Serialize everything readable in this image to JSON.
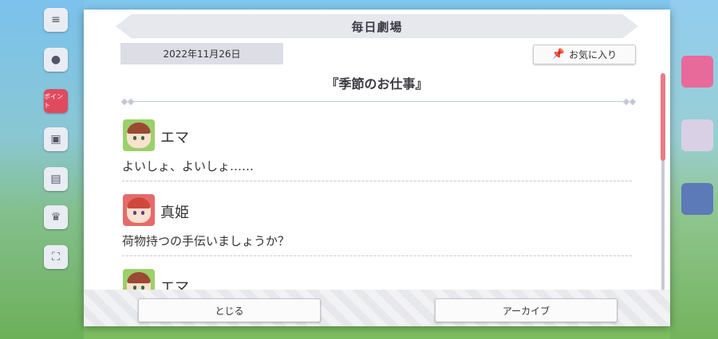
{
  "panel": {
    "title": "毎日劇場",
    "date": "2022年11月26日",
    "favorite_label": "お気に入り",
    "story_title": "『季節のお仕事』"
  },
  "entries": [
    {
      "speaker": "エマ",
      "text": "よいしょ、よいしょ……"
    },
    {
      "speaker": "真姫",
      "text": "荷物持つの手伝いましょうか？"
    },
    {
      "speaker": "エマ",
      "text": ""
    }
  ],
  "buttons": {
    "close_label": "とじる",
    "archive_label": "アーカイブ"
  },
  "side_menu": {
    "event_badge": "ポイント"
  },
  "colors": {
    "scroll_thumb": "#ea7a86",
    "title_ribbon": "#e7e8ee",
    "date_box": "#dcdde5"
  }
}
